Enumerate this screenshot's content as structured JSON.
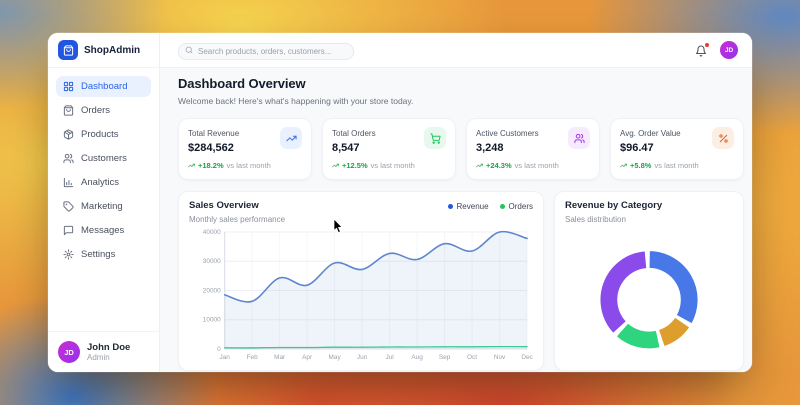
{
  "sidebar": {
    "brand": "ShopAdmin",
    "items": [
      {
        "label": "Dashboard",
        "icon": "grid",
        "active": true
      },
      {
        "label": "Orders",
        "icon": "shopping-bag",
        "active": false
      },
      {
        "label": "Products",
        "icon": "package",
        "active": false
      },
      {
        "label": "Customers",
        "icon": "users",
        "active": false
      },
      {
        "label": "Analytics",
        "icon": "bar-chart",
        "active": false
      },
      {
        "label": "Marketing",
        "icon": "tag",
        "active": false
      },
      {
        "label": "Messages",
        "icon": "message-square",
        "active": false
      },
      {
        "label": "Settings",
        "icon": "settings",
        "active": false
      }
    ],
    "user": {
      "initials": "JD",
      "name": "John Doe",
      "role": "Admin"
    }
  },
  "header": {
    "search": {
      "placeholder": "Search products, orders, customers..."
    },
    "notifications": {
      "has_unread": true
    },
    "avatar": {
      "initials": "JD"
    }
  },
  "main": {
    "title": "Dashboard Overview",
    "subtitle": "Welcome back! Here's what's happening with your store today.",
    "stats": [
      {
        "label": "Total Revenue",
        "value": "$284,562",
        "change": "+18.2%",
        "suffix": "vs last month",
        "icon": "trending-up",
        "accent": "#3b6fe0",
        "accent_bg": "#e9f1fe"
      },
      {
        "label": "Total Orders",
        "value": "8,547",
        "change": "+12.5%",
        "suffix": "vs last month",
        "icon": "cart",
        "accent": "#22c55e",
        "accent_bg": "#e7f9ef"
      },
      {
        "label": "Active Customers",
        "value": "3,248",
        "change": "+24.3%",
        "suffix": "vs last month",
        "icon": "users",
        "accent": "#a43ae0",
        "accent_bg": "#f6ebfe"
      },
      {
        "label": "Avg. Order Value",
        "value": "$96.47",
        "change": "+5.8%",
        "suffix": "vs last month",
        "icon": "percent",
        "accent": "#e0642f",
        "accent_bg": "#fdeee3"
      }
    ]
  },
  "chart_data": [
    {
      "type": "line",
      "title": "Sales Overview",
      "subtitle": "Monthly sales performance",
      "x": [
        "Jan",
        "Feb",
        "Mar",
        "Apr",
        "May",
        "Jun",
        "Jul",
        "Aug",
        "Sep",
        "Oct",
        "Nov",
        "Dec"
      ],
      "series": [
        {
          "name": "Revenue",
          "color": "#2456e0",
          "stroke": "#5e86cd",
          "fill": "rgba(94,134,205,0.10)",
          "values": [
            18500,
            16300,
            24300,
            21800,
            29400,
            27200,
            32700,
            30600,
            36000,
            33500,
            40000,
            37800
          ]
        },
        {
          "name": "Orders",
          "color": "#1fc75a",
          "stroke": "#3bcf8e",
          "fill": "none",
          "values": [
            420,
            400,
            520,
            500,
            620,
            600,
            700,
            680,
            760,
            740,
            820,
            800
          ]
        }
      ],
      "ylim": [
        0,
        40000
      ],
      "yticks": [
        0,
        10000,
        20000,
        30000,
        40000
      ],
      "grid": true,
      "legend_position": "top-right"
    },
    {
      "type": "pie",
      "donut": true,
      "title": "Revenue by Category",
      "subtitle": "Sales distribution",
      "segments": [
        {
          "color": "#4878e8",
          "value": 35
        },
        {
          "color": "#dd9e2e",
          "value": 11
        },
        {
          "color": "#2ed47e",
          "value": 16
        },
        {
          "color": "#8a4bea",
          "value": 38
        }
      ]
    }
  ]
}
